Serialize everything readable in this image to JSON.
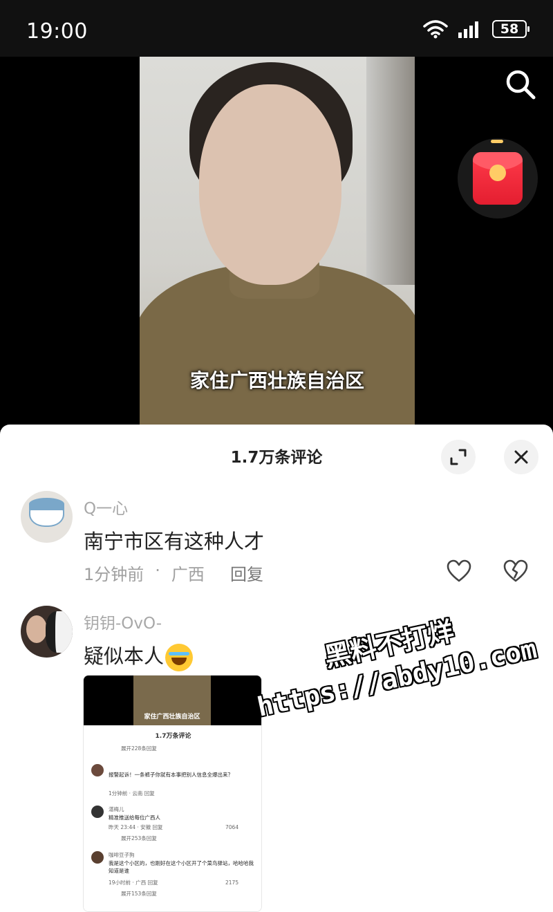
{
  "status_bar": {
    "time": "19:00",
    "battery": "58",
    "icons": [
      "wifi-icon",
      "signal-icon",
      "battery-icon"
    ]
  },
  "video": {
    "subtitle": "家住广西壮族自治区",
    "icons": [
      "search-icon",
      "red-packet-icon"
    ]
  },
  "comments_panel": {
    "title": "1.7万条评论",
    "icons": [
      "expand-icon",
      "close-icon",
      "heart-icon",
      "broken-heart-icon"
    ],
    "comments": [
      {
        "username": "Q一心",
        "text": "南宁市区有这种人才",
        "time": "1分钟前",
        "separator": "·",
        "location": "广西",
        "reply_label": "回复"
      },
      {
        "username": "钥钥-OvO-",
        "text": "疑似本人",
        "emoji": "crying-laughing-emoji"
      }
    ],
    "attached_screenshot": {
      "subtitle": "家住广西壮族自治区",
      "title": "1.7万条评论",
      "expand_1": "展开228条回复",
      "c1_text": "报警起诉！一条裤子你就有本事把别人信息全爆出来？",
      "c1_meta": "1分钟前 · 云南   回复",
      "c2_user": "湛梅儿",
      "c2_text": "精准推送给每位广西人",
      "c2_meta": "昨天 23:44 · 安徽   回复",
      "c2_likes": "7064",
      "expand_2": "展开253条回复",
      "c3_user": "咖啡豆子狗",
      "c3_text": "我是这个小区的，也刚好在这个小区开了个菜鸟驿站，哈哈哈我知道是谁",
      "c3_meta": "19小时前 · 广西   回复",
      "c3_likes": "2175",
      "expand_3": "展开153条回复"
    }
  },
  "watermark": {
    "line1": "黑料不打烊",
    "line2": "https://abdy10.com"
  }
}
